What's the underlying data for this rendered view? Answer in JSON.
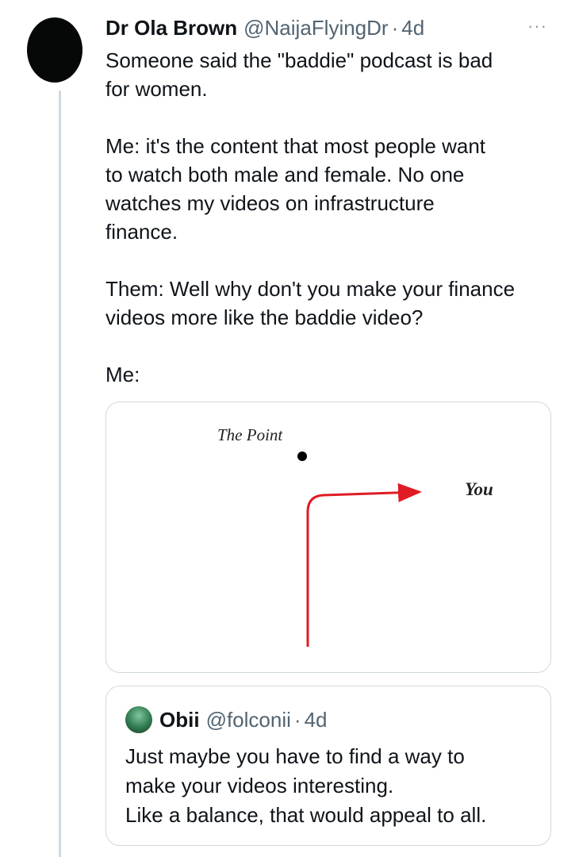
{
  "tweet": {
    "author_name": "Dr Ola Brown",
    "handle": "@NaijaFlyingDr",
    "separator": "·",
    "time": "4d",
    "more_label": "···",
    "text": "Someone said the \"baddie\" podcast is bad\nfor women.\n\nMe: it's the content that most people want\nto watch both male and female. No one\nwatches my videos on infrastructure\nfinance.\n\nThem: Well why don't you make your finance\nvideos more like the baddie video?\n\nMe:"
  },
  "media": {
    "point_label": "The Point",
    "you_label": "You",
    "arrow_color": "#e01b24",
    "point_color": "#000000"
  },
  "quote": {
    "author_name": "Obii",
    "handle": "@folconii",
    "separator": "·",
    "time": "4d",
    "text": "Just maybe you have to find a way to\nmake your videos interesting.\nLike a balance, that would appeal to all."
  },
  "colors": {
    "text": "#0f1419",
    "secondary": "#536471",
    "border": "#cfd9de"
  }
}
